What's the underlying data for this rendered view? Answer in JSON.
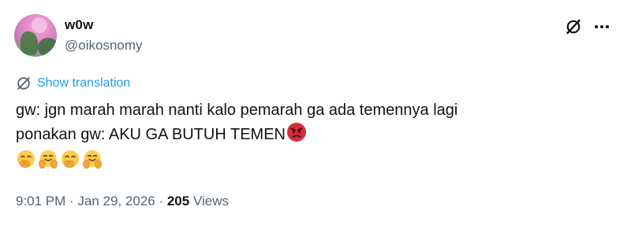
{
  "author": {
    "display_name": "w0w",
    "handle": "@oikosnomy"
  },
  "header": {
    "grok_icon": "grok-slash-circle-icon",
    "more_icon": "more-dots-icon"
  },
  "translation": {
    "label": "Show translation",
    "icon": "globe-slash-icon"
  },
  "tweet": {
    "line1": "gw: jgn marah marah nanti kalo pemarah ga ada temennya lagi",
    "line2": "ponakan gw: AKU GA BUTUH TEMEN",
    "line2_emoji": "angry-face-emoji",
    "emoji_row": [
      "face-with-hand-over-mouth-emoji",
      "hugging-face-emoji",
      "face-with-hand-over-mouth-emoji",
      "hugging-face-emoji"
    ]
  },
  "meta": {
    "time": "9:01 PM",
    "separator": " · ",
    "date": "Jan 29, 2026",
    "views_count": "205",
    "views_label": " Views"
  },
  "colors": {
    "accent": "#1d9bf0",
    "secondary_text": "#536471",
    "primary_text": "#0f1419"
  }
}
